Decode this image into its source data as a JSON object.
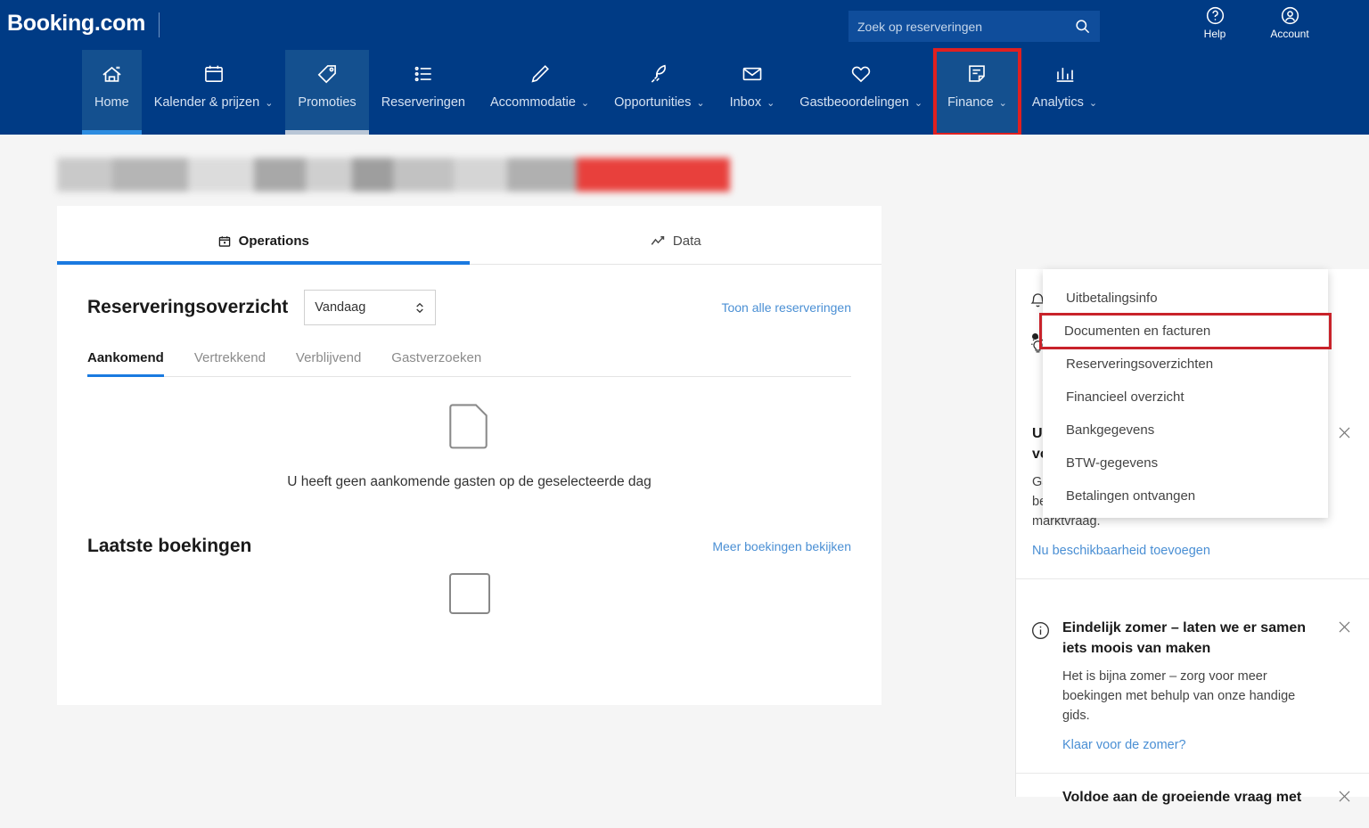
{
  "brand": {
    "name": "Booking.com"
  },
  "search": {
    "placeholder": "Zoek op reserveringen",
    "value": "",
    "icon": "search-icon"
  },
  "header_actions": [
    {
      "label": "Help",
      "icon": "help-circle-icon"
    },
    {
      "label": "Account",
      "icon": "account-circle-icon"
    }
  ],
  "nav": {
    "items": [
      {
        "label": "Home",
        "icon": "home-icon",
        "caret": false,
        "state": "active"
      },
      {
        "label": "Kalender & prijzen",
        "icon": "calendar-icon",
        "caret": true,
        "state": ""
      },
      {
        "label": "Promoties",
        "icon": "tag-icon",
        "caret": false,
        "state": "hovered"
      },
      {
        "label": "Reserveringen",
        "icon": "list-icon",
        "caret": false,
        "state": ""
      },
      {
        "label": "Accommodatie",
        "icon": "pencil-icon",
        "caret": true,
        "state": ""
      },
      {
        "label": "Opportunities",
        "icon": "rocket-icon",
        "caret": true,
        "state": ""
      },
      {
        "label": "Inbox",
        "icon": "envelope-icon",
        "caret": true,
        "state": ""
      },
      {
        "label": "Gastbeoordelingen",
        "icon": "heart-icon",
        "caret": true,
        "state": ""
      },
      {
        "label": "Finance",
        "icon": "document-note-icon",
        "caret": true,
        "state": "highlight"
      },
      {
        "label": "Analytics",
        "icon": "bar-chart-icon",
        "caret": true,
        "state": ""
      }
    ]
  },
  "dropdown": {
    "open_for": "Finance",
    "highlight_color": "#c8222a",
    "items": [
      {
        "label": "Uitbetalingsinfo",
        "highlighted": false
      },
      {
        "label": "Documenten en facturen",
        "highlighted": true
      },
      {
        "label": "Reserveringsoverzichten",
        "highlighted": false
      },
      {
        "label": "Financieel overzicht",
        "highlighted": false
      },
      {
        "label": "Bankgegevens",
        "highlighted": false
      },
      {
        "label": "BTW-gegevens",
        "highlighted": false
      },
      {
        "label": "Betalingen ontvangen",
        "highlighted": false
      }
    ]
  },
  "main": {
    "tabs": [
      {
        "label": "Operations",
        "icon": "calendar-day-icon",
        "active": true
      },
      {
        "label": "Data",
        "icon": "trend-line-icon",
        "active": false
      }
    ],
    "reservations": {
      "title": "Reserveringsoverzicht",
      "day_filter": {
        "value": "Vandaag",
        "icon": "chevron-updown-icon"
      },
      "show_all_link": "Toon alle reserveringen",
      "subtabs": [
        {
          "label": "Aankomend",
          "active": true
        },
        {
          "label": "Vertrekkend",
          "active": false
        },
        {
          "label": "Verblijvend",
          "active": false
        },
        {
          "label": "Gastverzoeken",
          "active": false
        }
      ],
      "empty_state": {
        "icon": "document-corner-fold-icon",
        "text": "U heeft geen aankomende gasten op de geselecteerde dag"
      }
    },
    "last_bookings": {
      "title": "Laatste boekingen",
      "more_link": "Meer boekingen bekijken",
      "placeholder_icon": "document-outline-icon"
    },
    "redacted_bar": {
      "segments": [
        "#c9c9c9",
        "#b5b5b5",
        "#dcdcdc",
        "#a8a8a8",
        "#cfcfcf",
        "#9e9e9e",
        "#c2c2c2",
        "#d5d5d5",
        "#b0b0b0",
        "#e8403c",
        "#e8403c"
      ]
    }
  },
  "sidebar": {
    "icons": [
      {
        "name": "bell-icon"
      },
      {
        "name": "lightbulb-icon"
      }
    ],
    "cards": [
      {
        "id": "availability",
        "title_line1": "U h",
        "title_line2": "vo",
        "body": "Gas\nbes\nmarktvraag.",
        "link": "Nu beschikbaarheid toevoegen",
        "close_icon": "close-icon",
        "partially_hidden": true
      },
      {
        "id": "summer",
        "info_icon": "info-circle-icon",
        "title": "Eindelijk zomer – laten we er samen iets moois van maken",
        "body": "Het is bijna zomer – zorg voor meer boekingen met behulp van onze handige gids.",
        "link": "Klaar voor de zomer?",
        "close_icon": "close-icon"
      },
      {
        "id": "demand",
        "title": "Voldoe aan de groeiende vraag met",
        "close_icon": "close-icon"
      }
    ]
  },
  "colors": {
    "header_blue": "#003b85",
    "nav_active_blue": "#14508f",
    "accent_blue": "#2d8ce0",
    "link_blue": "#4a8fd4",
    "highlight_red": "#e02020",
    "page_bg": "#f5f5f5"
  }
}
